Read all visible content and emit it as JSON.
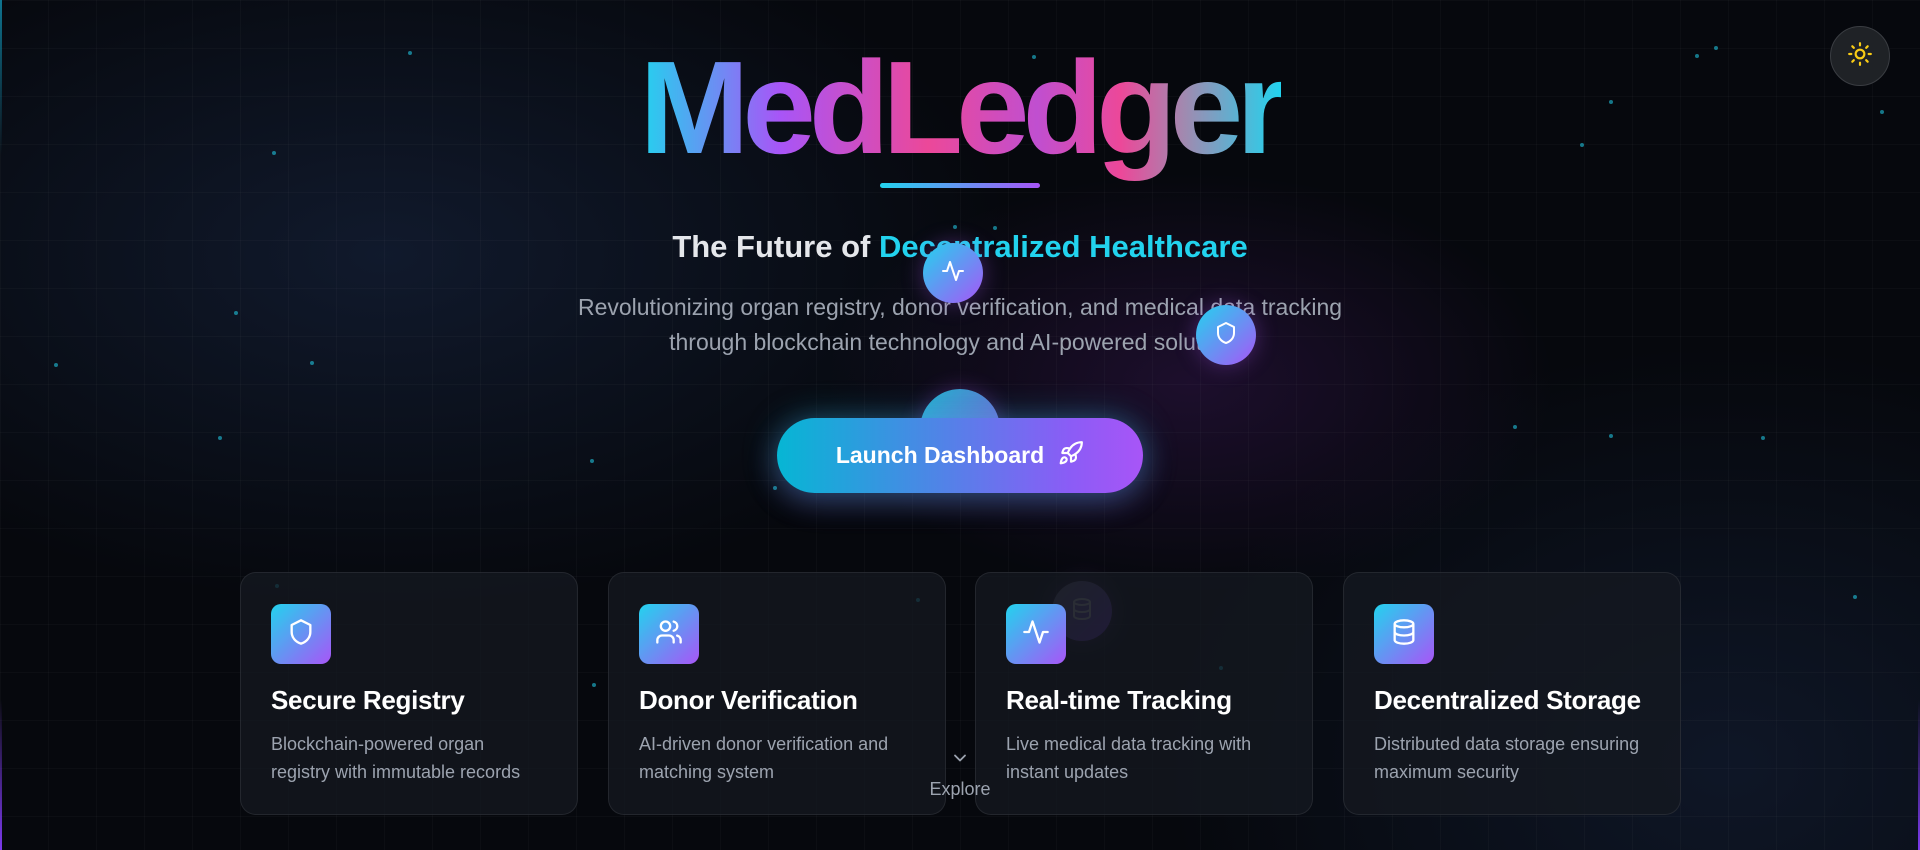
{
  "brand": {
    "name": "MedLedger"
  },
  "hero": {
    "tagline_prefix": "The Future of ",
    "tagline_highlight": "Decentralized Healthcare",
    "subtitle_line1": "Revolutionizing organ registry, donor verification, and medical data tracking",
    "subtitle_line2": "through blockchain technology and AI-powered solutions.",
    "cta_label": "Launch Dashboard",
    "cta_icon": "rocket-icon"
  },
  "theme_toggle": {
    "icon": "sun-icon"
  },
  "features": [
    {
      "icon": "shield-icon",
      "title": "Secure Registry",
      "description": "Blockchain-powered organ registry with immutable records"
    },
    {
      "icon": "users-icon",
      "title": "Donor Verification",
      "description": "AI-driven donor verification and matching system"
    },
    {
      "icon": "activity-icon",
      "title": "Real-time Tracking",
      "description": "Live medical data tracking with instant updates"
    },
    {
      "icon": "database-icon",
      "title": "Decentralized Storage",
      "description": "Distributed data storage ensuring maximum security"
    }
  ],
  "explore": {
    "label": "Explore",
    "icon": "chevron-down-icon"
  },
  "colors": {
    "accent_cyan": "#22d3ee",
    "accent_purple": "#a855f7",
    "accent_pink": "#ec4899",
    "background": "#06080d",
    "sun": "#facc15"
  }
}
